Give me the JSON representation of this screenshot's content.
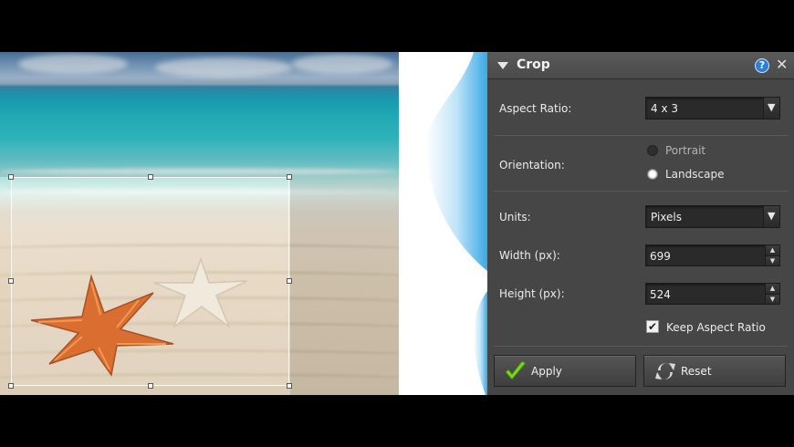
{
  "panel": {
    "title": "Crop",
    "aspect_ratio": {
      "label": "Aspect Ratio:",
      "value": "4 x 3"
    },
    "orientation": {
      "label": "Orientation:",
      "options": [
        {
          "label": "Portrait",
          "selected": false
        },
        {
          "label": "Landscape",
          "selected": true
        }
      ]
    },
    "units": {
      "label": "Units:",
      "value": "Pixels"
    },
    "width": {
      "label": "Width (px):",
      "value": "699"
    },
    "height": {
      "label": "Height (px):",
      "value": "524"
    },
    "keep_aspect": {
      "label": "Keep Aspect Ratio",
      "checked": true
    },
    "apply_label": "Apply",
    "reset_label": "Reset"
  },
  "icons": {
    "collapse": "triangle-down-icon",
    "help": "help-icon",
    "close": "close-icon",
    "apply": "checkmark-icon",
    "reset": "refresh-icon"
  },
  "colors": {
    "panel_bg": "#464646",
    "help_blue": "#2f7fd6",
    "apply_green": "#7ed321",
    "starfish_orange": "#d45a14"
  }
}
